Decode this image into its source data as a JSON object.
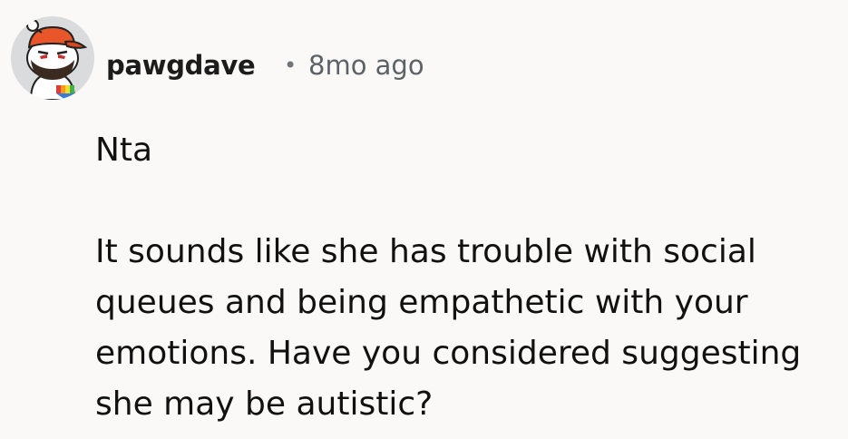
{
  "comment": {
    "author": {
      "username": "pawgdave",
      "avatar": "snoo-avatar-icon"
    },
    "separator": "•",
    "timestamp": "8mo ago",
    "paragraphs": [
      "Nta",
      "It sounds like she has trouble with social queues and being empathetic with your emotions. Have you considered suggesting she may be autistic?"
    ]
  },
  "colors": {
    "background": "#fbf9f8",
    "username": "#1c1c1c",
    "meta": "#5c6367",
    "hat": "#e8562a",
    "text": "#111111"
  }
}
